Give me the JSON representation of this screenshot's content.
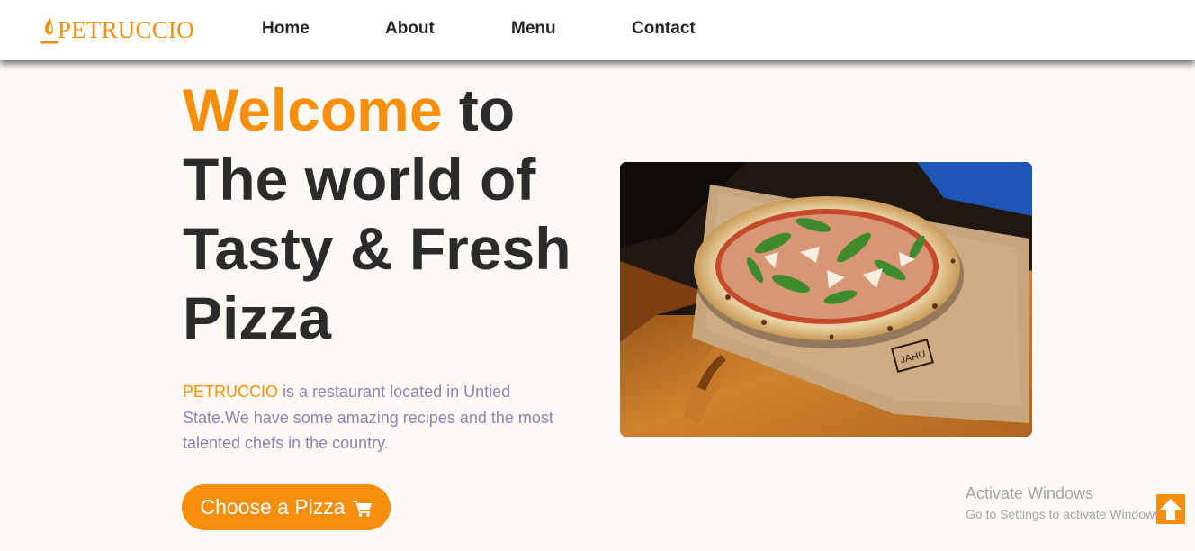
{
  "brand": {
    "name": "PETRUCCIO",
    "accent_color": "#f78f0c"
  },
  "nav": {
    "items": [
      {
        "label": "Home"
      },
      {
        "label": "About"
      },
      {
        "label": "Menu"
      },
      {
        "label": "Contact"
      }
    ]
  },
  "hero": {
    "title_accent": "Welcome",
    "title_rest": " to The world of Tasty & Fresh Pizza",
    "description_brand": "PETRUCCIO",
    "description_rest": " is a restaurant located in Untied State.We have some amazing recipes and the most talented chefs in the country.",
    "cta_label": "Choose a Pizza",
    "cta_icon": "shopping-cart-icon",
    "image_stamp": "JAHU"
  },
  "windows_watermark": {
    "title": "Activate Windows",
    "subtitle": "Go to Settings to activate Windows."
  },
  "scroll_top": {
    "icon": "arrow-up-icon"
  }
}
